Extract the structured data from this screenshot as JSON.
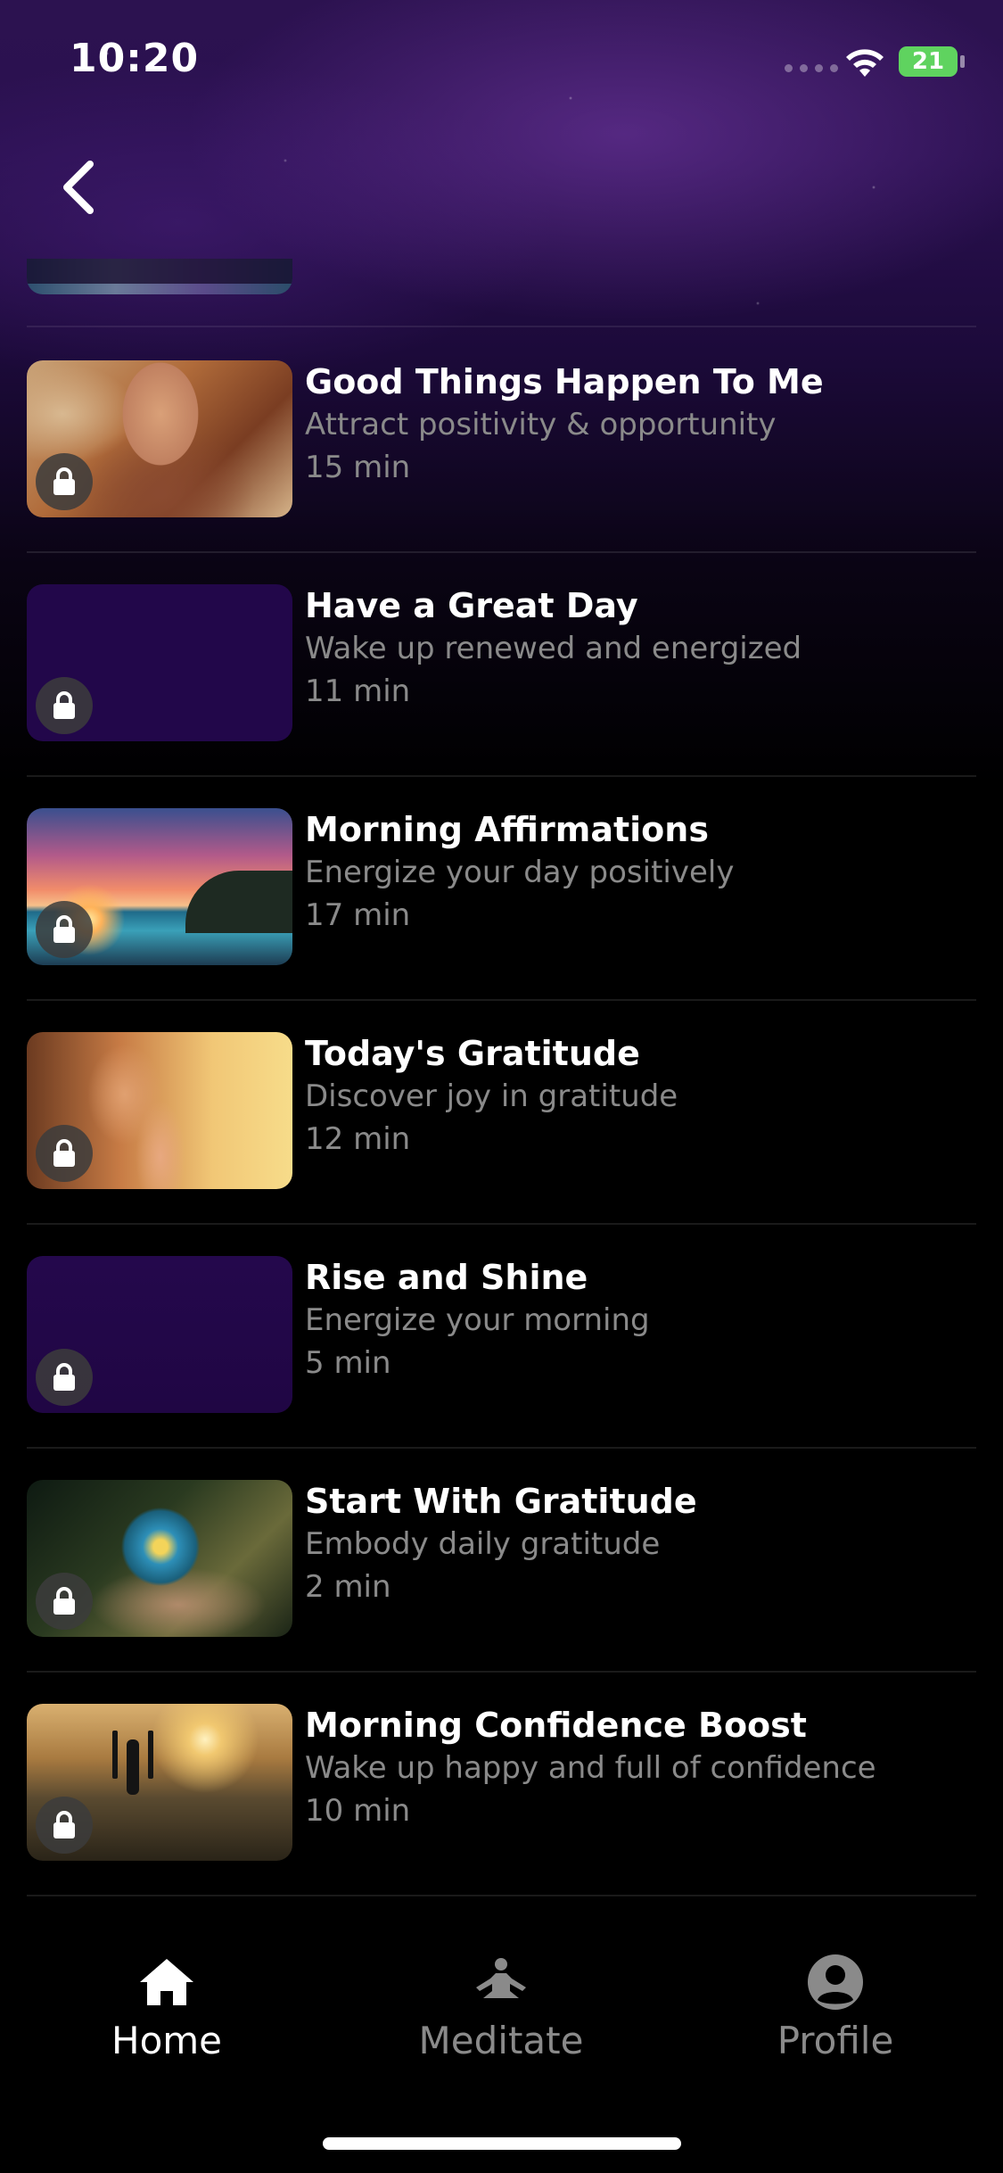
{
  "status_bar": {
    "time": "10:20",
    "battery": "21"
  },
  "items": [
    {
      "title": "Good Things Happen To Me",
      "subtitle": "Attract positivity & opportunity",
      "duration": "15 min",
      "image": "woman-wind"
    },
    {
      "title": "Have a Great Day",
      "subtitle": "Wake up renewed and energized",
      "duration": "11 min",
      "image": "purple-placeholder"
    },
    {
      "title": "Morning Affirmations",
      "subtitle": "Energize your day positively",
      "duration": "17 min",
      "image": "sunset-beach"
    },
    {
      "title": "Today's Gratitude",
      "subtitle": "Discover joy in gratitude",
      "duration": "12 min",
      "image": "praying-woman"
    },
    {
      "title": "Rise and Shine",
      "subtitle": "Energize your morning",
      "duration": "5 min",
      "image": "purple-placeholder"
    },
    {
      "title": "Start With Gratitude",
      "subtitle": "Embody daily gratitude",
      "duration": "2 min",
      "image": "flower-hand"
    },
    {
      "title": "Morning Confidence Boost",
      "subtitle": "Wake up happy and full of confidence",
      "duration": "10 min",
      "image": "mountain-man"
    }
  ],
  "tabs": [
    {
      "label": "Home",
      "icon": "home-icon",
      "active": true
    },
    {
      "label": "Meditate",
      "icon": "meditate-icon",
      "active": false
    },
    {
      "label": "Profile",
      "icon": "profile-icon",
      "active": false
    }
  ],
  "colors": {
    "background": "#000000",
    "accent_purple": "#2a1050",
    "secondary_text": "#8a8a8a",
    "battery": "#5fd35f"
  }
}
